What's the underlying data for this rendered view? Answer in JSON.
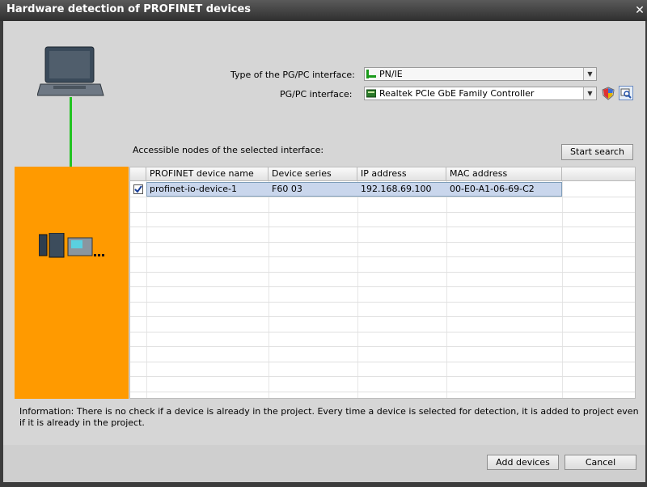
{
  "window": {
    "title": "Hardware detection of PROFINET devices"
  },
  "interface_type": {
    "label": "Type of the PG/PC interface:",
    "value": "PN/IE"
  },
  "pgpc_interface": {
    "label": "PG/PC interface:",
    "value": "Realtek PCIe GbE Family Controller"
  },
  "nodes": {
    "label": "Accessible nodes of the selected interface:",
    "start_search": "Start search"
  },
  "table": {
    "headers": [
      "PROFINET device name",
      "Device series",
      "IP address",
      "MAC address"
    ],
    "rows": [
      {
        "checked": true,
        "device_name": "profinet-io-device-1",
        "series": "F60 03",
        "ip": "192.168.69.100",
        "mac": "00-E0-A1-06-69-C2"
      }
    ]
  },
  "info_text": "Information: There is no check if a device is already in the project. Every time a device is selected for detection, it is added to project even if it is already in the project.",
  "buttons": {
    "add": "Add devices",
    "cancel": "Cancel"
  },
  "colors": {
    "accent_orange": "#FF9A00",
    "link_green": "#22C422",
    "selected_row": "#C9D6EC"
  }
}
